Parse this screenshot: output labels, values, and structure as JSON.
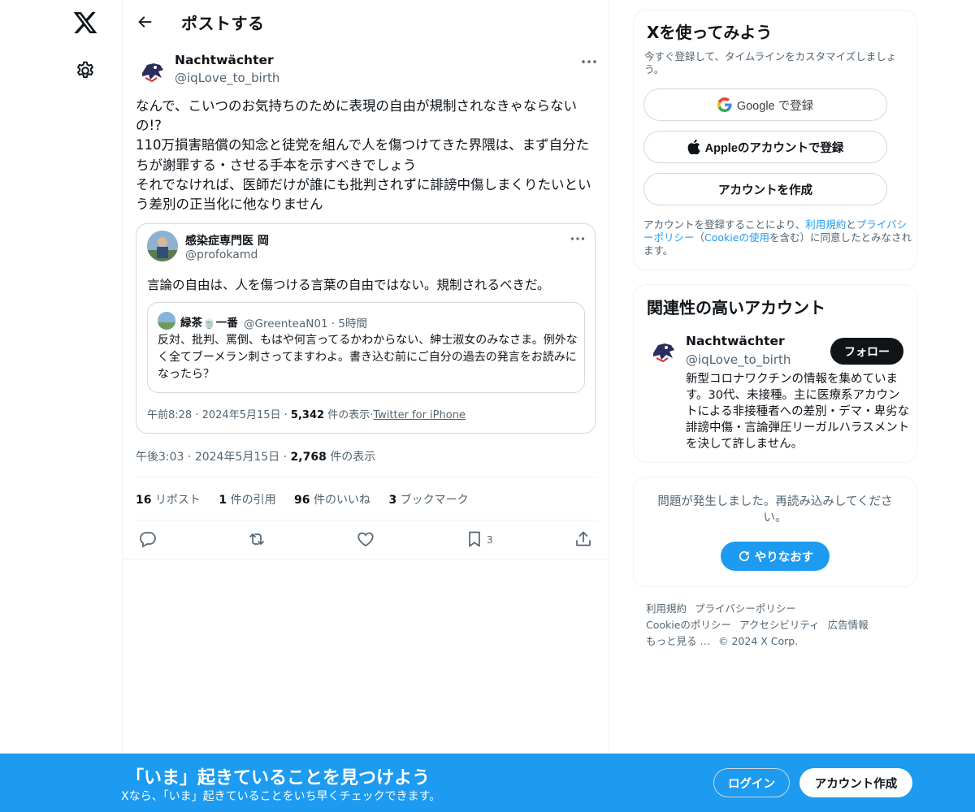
{
  "header": {
    "title": "ポストする"
  },
  "post": {
    "author_name": "Nachtwächter",
    "author_handle": "@iqLove_to_birth",
    "text": "なんで、こいつのお気持ちのために表現の自由が規制されなきゃならないの!?\n110万損害賠償の知念と徒党を組んで人を傷つけてきた界隈は、まず自分たちが謝罪する・させる手本を示すべきでしょう\nそれでなければ、医師だけが誰にも批判されずに誹謗中傷しまくりたいという差別の正当化に他なりません",
    "time": "午後3:03",
    "date": "2024年5月15日",
    "views_count": "2,768",
    "views_label": "件の表示"
  },
  "quote": {
    "author_name": "感染症専門医 岡",
    "author_handle": "@profokamd",
    "text": "言論の自由は、人を傷つける言葉の自由ではない。規制されるべきだ。",
    "inner": {
      "author_name": "緑茶🍵一番",
      "handle_time": "@GreenteaN01 · 5時間",
      "text": "反対、批判、罵倒、もはや何言ってるかわからない、紳士淑女のみなさま。例外なく全てブーメラン刺さってますわよ。書き込む前にご自分の過去の発言をお読みになったら？"
    },
    "time": "午前8:28",
    "date": "2024年5月15日",
    "views_count": "5,342",
    "views_label": "件の表示",
    "source": "Twitter for iPhone"
  },
  "stats": {
    "reposts_count": "16",
    "reposts_label": "リポスト",
    "quotes_count": "1",
    "quotes_label": "件の引用",
    "likes_count": "96",
    "likes_label": "件のいいね",
    "bookmarks_count": "3",
    "bookmarks_label": "ブックマーク"
  },
  "actions": {
    "bookmark_count": "3"
  },
  "signup_card": {
    "title": "Xを使ってみよう",
    "subtitle": "今すぐ登録して、タイムラインをカスタマイズしましょう。",
    "google_brand": "Google",
    "google_suffix": " で登録",
    "apple_label": "Appleのアカウントで登録",
    "create_label": "アカウントを作成",
    "legal_prefix": "アカウントを登録することにより、",
    "terms_link": "利用規約",
    "legal_and": "と",
    "privacy_link": "プライバシーポリシー",
    "legal_open": "（",
    "cookie_link": "Cookieの使用",
    "legal_suffix": "を含む）に同意したとみなされます。"
  },
  "related": {
    "title": "関連性の高いアカウント",
    "name": "Nachtwächter",
    "handle": "@iqLove_to_birth",
    "follow_label": "フォロー",
    "bio": "新型コロナワクチンの情報を集めています。30代、未接種。主に医療系アカウントによる非接種者への差別・デマ・卑劣な誹謗中傷・言論弾圧リーガルハラスメントを決して許しません。"
  },
  "error_card": {
    "message": "問題が発生しました。再読み込みしてください。",
    "retry_label": "やりなおす"
  },
  "footer": {
    "terms": "利用規約",
    "privacy": "プライバシーポリシー",
    "cookie": "Cookieのポリシー",
    "accessibility": "アクセシビリティ",
    "ads": "広告情報",
    "more": "もっと見る …",
    "copyright": "© 2024 X Corp."
  },
  "banner": {
    "title": "「いま」起きていることを見つけよう",
    "subtitle": "Xなら、「いま」起きていることをいち早くチェックできます。",
    "login_label": "ログイン",
    "signup_label": "アカウント作成"
  },
  "colors": {
    "accent": "#1d9bf0",
    "text": "#0f1419",
    "muted": "#536471",
    "border": "#cfd9de"
  }
}
